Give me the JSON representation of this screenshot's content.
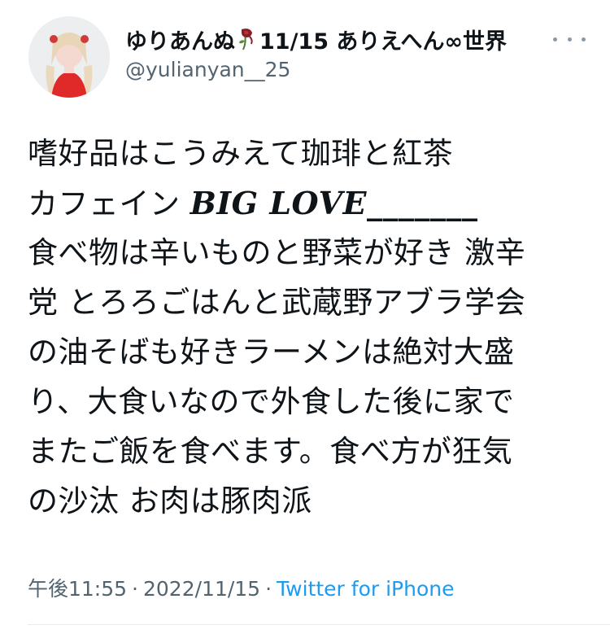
{
  "author": {
    "display_name_before_icon": "ゆりあんぬ",
    "display_name_icon": "wilted-rose-icon",
    "display_name_after_icon": "11/15 ありえへん∞世界",
    "handle": "@yulianyan__25"
  },
  "tweet": {
    "lines": [
      "嗜好品はこうみえて珈琲と紅茶",
      "カフェイン ",
      "食べ物は辛いものと野菜が好き 激辛",
      "党 とろろごはんと武蔵野アブラ学会",
      "の油そばも好きラーメンは絶対大盛",
      "り、大食いなので外食した後に家で",
      "またご飯を食べます。食べ方が狂気",
      "の沙汰 お肉は豚肉派"
    ],
    "styled_text": "BIG LOVE_______"
  },
  "meta": {
    "time": "午後11:55",
    "separator": "·",
    "date": "2022/11/15",
    "source": "Twitter for iPhone"
  },
  "colors": {
    "text": "#0f1419",
    "secondary": "#536471",
    "link": "#1d9bf0"
  }
}
